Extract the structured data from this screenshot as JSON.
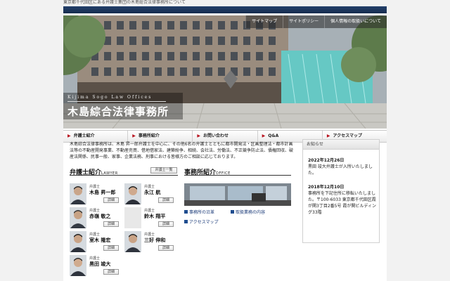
{
  "tagline": "東京都千代田区にある弁護士集団の木島総合法律事務所について",
  "header": {
    "links": [
      "サイトマップ",
      "サイトポリシー",
      "個人情報の取扱いについて"
    ],
    "logo_en": "Kijima Sogo Law Offices",
    "logo_jp": "木島綜合法律事務所"
  },
  "nav": [
    {
      "label": "弁護士紹介"
    },
    {
      "label": "事務所紹介"
    },
    {
      "label": "お問い合わせ"
    },
    {
      "label": "Q&A"
    },
    {
      "label": "アクセスマップ"
    }
  ],
  "intro": "木島綜合法律事務所は、木島 昇一郎弁護士を中心に、その他6名の弁護士とともに都市開発法・区画整理法・都市計画法等の不動産開発事業、不動産売買、借地借家法、建築紛争、相続、会社法、労働法、不正競争防止法、債権回収、破産法関係、民事一般、家事、企業法務、刑事における皆様方のご相談に応じております。",
  "lawyers_section": {
    "title": "弁護士紹介",
    "title_en": "LAWYER",
    "list_button": "弁護士一覧",
    "more_label": "詳細",
    "items": [
      {
        "role": "弁護士",
        "name": "木島 昇一郎"
      },
      {
        "role": "弁護士",
        "name": "永江 航"
      },
      {
        "role": "弁護士",
        "name": "赤嶺 敬之"
      },
      {
        "role": "弁護士",
        "name": "鈴木 翔平"
      },
      {
        "role": "弁護士",
        "name": "室木 隆宏"
      },
      {
        "role": "弁護士",
        "name": "三好 伸和"
      },
      {
        "role": "弁護士",
        "name": "黒田 竣大"
      }
    ]
  },
  "office_section": {
    "title": "事務所紹介",
    "title_en": "OFFICE",
    "links": [
      "事務所の沿革",
      "取扱業務の内容",
      "アクセスマップ"
    ]
  },
  "news": {
    "title": "お知らせ",
    "items": [
      {
        "date": "2022年12月26日",
        "text": "黒田 竣大弁護士が入所いたしました。"
      },
      {
        "date": "2018年12月10日",
        "text": "事務所を下記住所に移転いたしました。〒100-6033 東京都千代田区霞が関3丁目2番5号 霞が関ビルディング33階"
      }
    ]
  }
}
